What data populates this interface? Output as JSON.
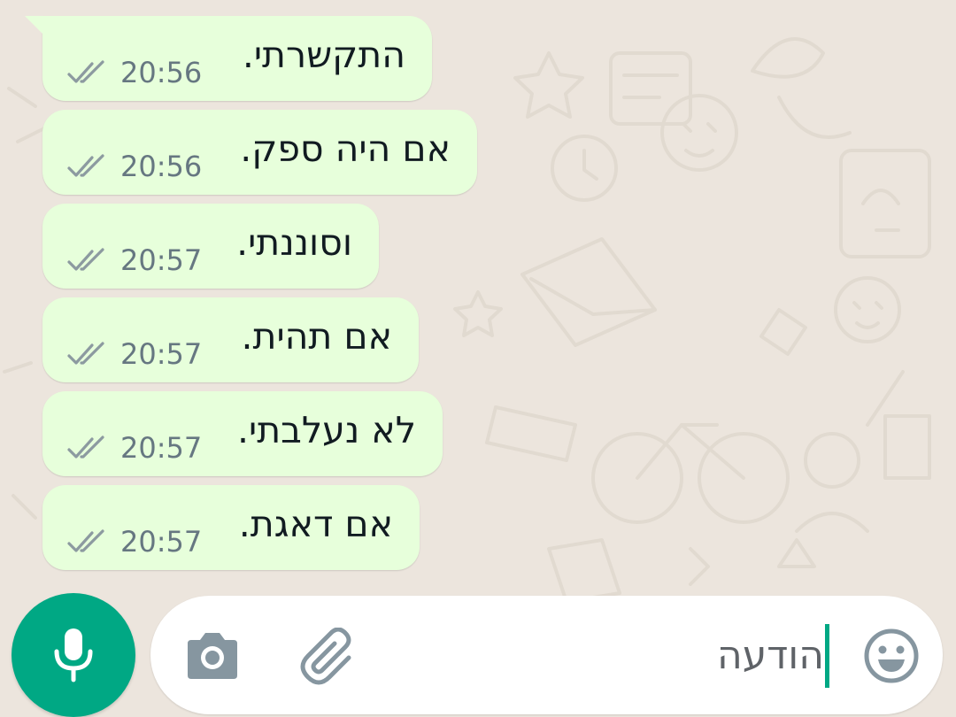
{
  "colors": {
    "wallpaper": "#ece5dd",
    "outgoing_bubble": "#e7ffdb",
    "accent": "#00a884",
    "ticks": "#8c9aa0",
    "time": "#667781",
    "composer_bg": "#ffffff"
  },
  "messages": [
    {
      "text": "התקשרתי.",
      "time": "20:56",
      "status_icon": "double-check-icon"
    },
    {
      "text": "אם היה ספק.",
      "time": "20:56",
      "status_icon": "double-check-icon"
    },
    {
      "text": "וסוננתי.",
      "time": "20:57",
      "status_icon": "double-check-icon"
    },
    {
      "text": "אם תהית.",
      "time": "20:57",
      "status_icon": "double-check-icon"
    },
    {
      "text": "לא נעלבתי.",
      "time": "20:57",
      "status_icon": "double-check-icon"
    },
    {
      "text": "אם דאגת.",
      "time": "20:57",
      "status_icon": "double-check-icon"
    }
  ],
  "composer": {
    "text": "הודעה",
    "emoji_icon": "emoji-icon",
    "attach_icon": "paperclip-icon",
    "camera_icon": "camera-icon"
  },
  "mic_button": {
    "icon": "microphone-icon"
  }
}
